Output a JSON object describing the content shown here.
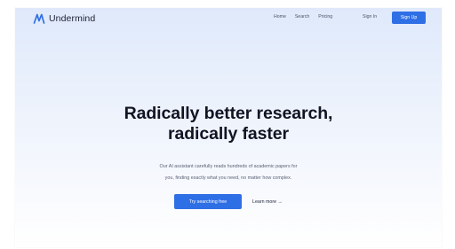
{
  "nav": {
    "brand": "Undermind",
    "links": [
      "Home",
      "Search",
      "Pricing"
    ],
    "sign_in": "Sign In",
    "sign_up": "Sign Up"
  },
  "hero": {
    "title_line1": "Radically better research,",
    "title_line2": "radically faster",
    "subtitle_line1": "Our AI assistant carefully reads hundreds of academic papers for",
    "subtitle_line2": "you, finding exactly what you need, no matter how complex.",
    "cta_primary": "Try searching free",
    "cta_secondary": "Learn more →"
  },
  "colors": {
    "accent": "#2f6fe6",
    "heading": "#111423",
    "body_text": "#5a6173",
    "background_top": "#dfe9fb"
  },
  "icons": {
    "logo": "undermind-logo-icon"
  }
}
